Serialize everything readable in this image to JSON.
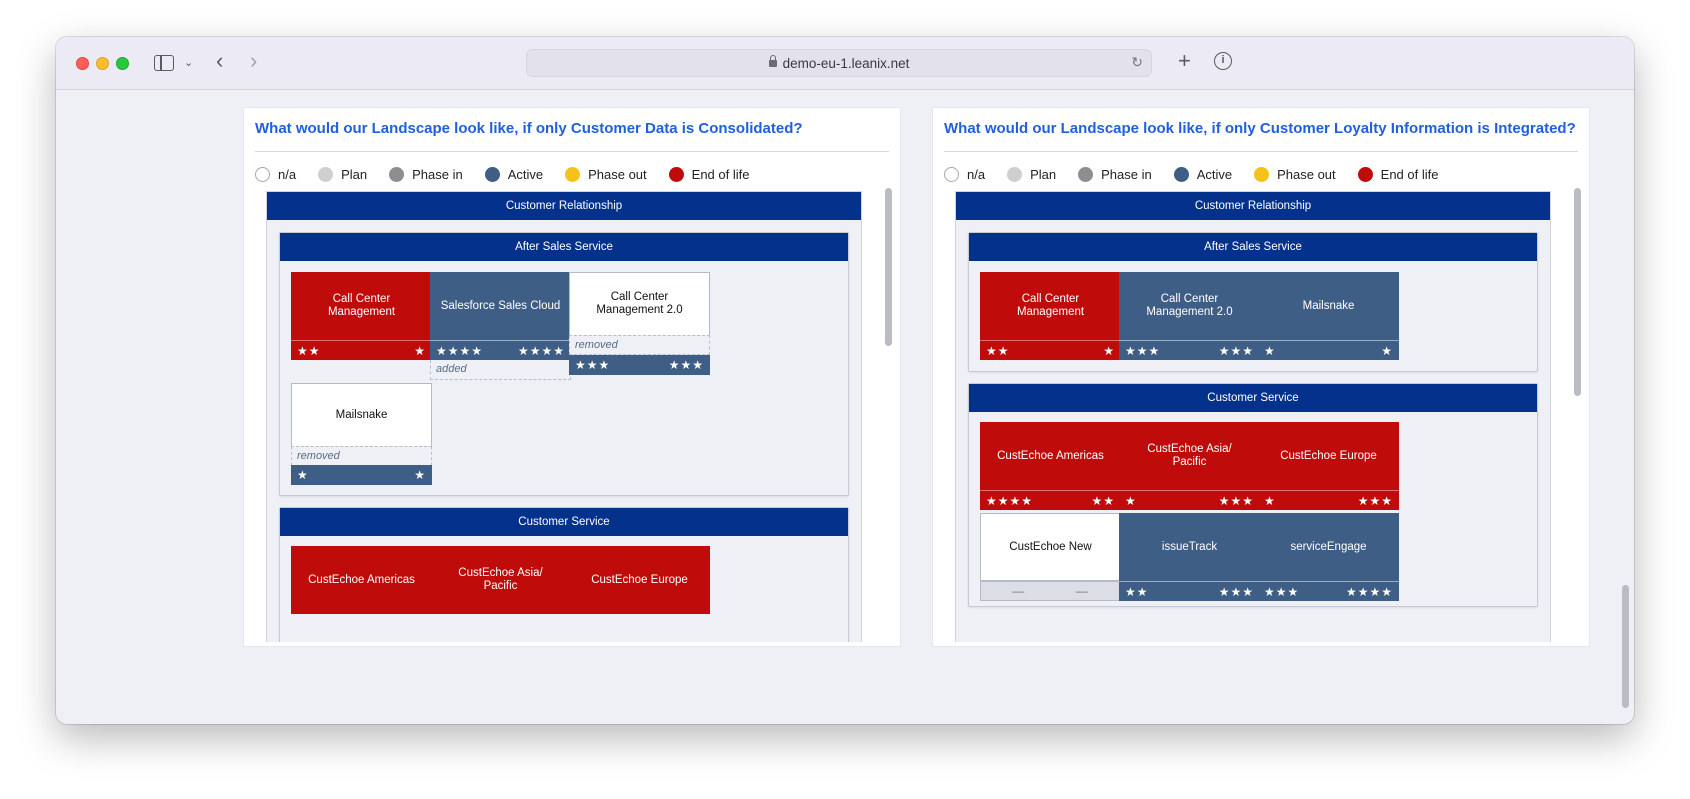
{
  "browser": {
    "url": "demo-eu-1.leanix.net",
    "icons": [
      "sidebar-icon",
      "chevron-down-icon",
      "back-icon",
      "forward-icon",
      "reload-icon",
      "new-tab-icon",
      "info-icon"
    ]
  },
  "legend": [
    {
      "label": "n/a",
      "color": "#ffffff"
    },
    {
      "label": "Plan",
      "color": "#cfcfd2"
    },
    {
      "label": "Phase in",
      "color": "#8e8e92"
    },
    {
      "label": "Active",
      "color": "#3f5e86"
    },
    {
      "label": "Phase out",
      "color": "#f5c21a"
    },
    {
      "label": "End of life",
      "color": "#c00b0b"
    }
  ],
  "left_panel": {
    "title": "What would our Landscape look like, if only Customer Data is Consolidated?",
    "domain": "Customer Relationship",
    "after_sales": {
      "title": "After Sales Service",
      "cards": [
        {
          "name": "Call Center Management",
          "left": "★★",
          "right": "★"
        },
        {
          "name": "Salesforce Sales Cloud",
          "left": "★★★★",
          "right": "★★★★",
          "tag": "added"
        },
        {
          "name": "Call Center Management 2.0",
          "left": "★★★",
          "right": "★★★",
          "tag": "removed"
        },
        {
          "name": "Mailsnake",
          "left": "★",
          "right": "★",
          "tag": "removed"
        }
      ]
    },
    "customer_service": {
      "title": "Customer Service",
      "cards": [
        {
          "name": "CustEchoe Americas"
        },
        {
          "name": "CustEchoe Asia/ Pacific"
        },
        {
          "name": "CustEchoe Europe"
        }
      ]
    }
  },
  "right_panel": {
    "title": "What would our Landscape look like, if only Customer Loyalty Information is Integrated?",
    "domain": "Customer Relationship",
    "after_sales": {
      "title": "After Sales Service",
      "cards": [
        {
          "name": "Call Center Management",
          "left": "★★",
          "right": "★"
        },
        {
          "name": "Call Center Management 2.0",
          "left": "★★★",
          "right": "★★★"
        },
        {
          "name": "Mailsnake",
          "left": "★",
          "right": "★"
        }
      ]
    },
    "customer_service": {
      "title": "Customer Service",
      "cards": [
        {
          "name": "CustEchoe Americas",
          "left": "★★★★",
          "right": "★★"
        },
        {
          "name": "CustEchoe Asia/ Pacific",
          "left": "★",
          "right": "★★★"
        },
        {
          "name": "CustEchoe Europe",
          "left": "★",
          "right": "★★★"
        },
        {
          "name": "CustEchoe New",
          "left": "—",
          "right": "—"
        },
        {
          "name": "issueTrack",
          "left": "★★",
          "right": "★★★"
        },
        {
          "name": "serviceEngage",
          "left": "★★★",
          "right": "★★★★"
        }
      ]
    }
  }
}
